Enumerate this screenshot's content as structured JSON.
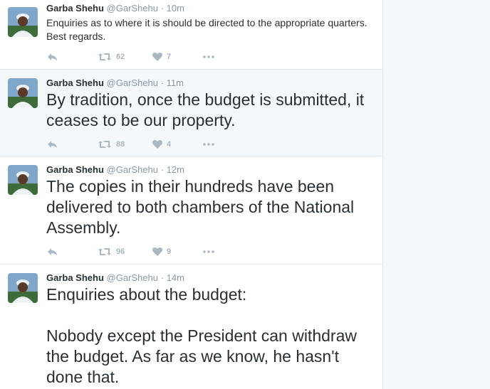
{
  "tweets": [
    {
      "name": "Garba Shehu",
      "handle": "@GarShehu",
      "separator": "·",
      "time": "10m",
      "text": "Enquiries as to where it is should be directed to the appropriate quarters. Best regards.",
      "retweets": "62",
      "likes": "7"
    },
    {
      "name": "Garba Shehu",
      "handle": "@GarShehu",
      "separator": "·",
      "time": "11m",
      "text": "By tradition, once the budget is submitted, it ceases to be our property.",
      "retweets": "88",
      "likes": "4"
    },
    {
      "name": "Garba Shehu",
      "handle": "@GarShehu",
      "separator": "·",
      "time": "12m",
      "text": "The copies in their hundreds have been delivered to both chambers of the National Assembly.",
      "retweets": "96",
      "likes": "9"
    },
    {
      "name": "Garba Shehu",
      "handle": "@GarShehu",
      "separator": "·",
      "time": "14m",
      "text": "Enquiries about the budget:\n\nNobody except the President can withdraw the budget. As far as we know, he hasn't done that."
    }
  ],
  "colors": {
    "text": "#292f33",
    "muted": "#8899a6",
    "icon": "#aab8c2",
    "highlight_bg": "#f5f8fa",
    "border": "#e1e8ed"
  }
}
